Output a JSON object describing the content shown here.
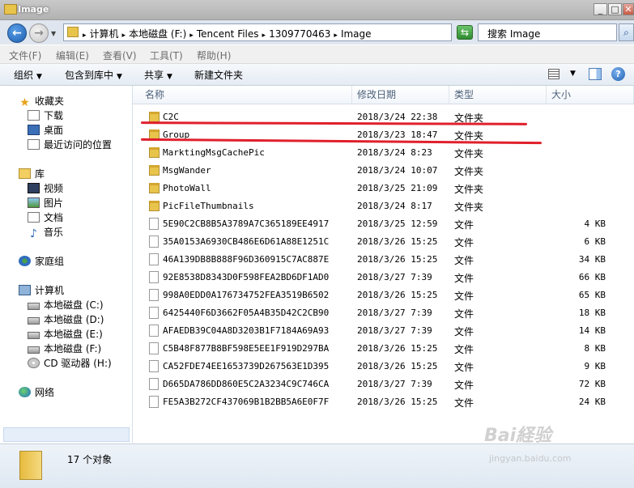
{
  "window": {
    "title": "Image"
  },
  "address": {
    "crumbs": [
      "计算机",
      "本地磁盘 (F:)",
      "Tencent Files",
      "1309770463",
      "Image"
    ],
    "separator": "▸"
  },
  "search": {
    "placeholder": "搜索 Image"
  },
  "menu": [
    "文件(F)",
    "编辑(E)",
    "查看(V)",
    "工具(T)",
    "帮助(H)"
  ],
  "toolbar": {
    "organize": "组织",
    "include": "包含到库中",
    "share": "共享",
    "new_folder": "新建文件夹"
  },
  "nav": {
    "favorites": "收藏夹",
    "downloads": "下载",
    "desktop": "桌面",
    "recent": "最近访问的位置",
    "libraries": "库",
    "videos": "视频",
    "pictures": "图片",
    "documents": "文档",
    "music": "音乐",
    "homegroup": "家庭组",
    "computer": "计算机",
    "drive_c": "本地磁盘 (C:)",
    "drive_d": "本地磁盘 (D:)",
    "drive_e": "本地磁盘 (E:)",
    "drive_f": "本地磁盘 (F:)",
    "cd_drive": "CD 驱动器 (H:)",
    "network": "网络"
  },
  "columns": {
    "name": "名称",
    "date": "修改日期",
    "type": "类型",
    "size": "大小"
  },
  "files": [
    {
      "name": "C2C",
      "date": "2018/3/24 22:38",
      "type": "文件夹",
      "size": "",
      "kind": "folder"
    },
    {
      "name": "Group",
      "date": "2018/3/23 18:47",
      "type": "文件夹",
      "size": "",
      "kind": "folder"
    },
    {
      "name": "MarktingMsgCachePic",
      "date": "2018/3/24 8:23",
      "type": "文件夹",
      "size": "",
      "kind": "folder"
    },
    {
      "name": "MsgWander",
      "date": "2018/3/24 10:07",
      "type": "文件夹",
      "size": "",
      "kind": "folder"
    },
    {
      "name": "PhotoWall",
      "date": "2018/3/25 21:09",
      "type": "文件夹",
      "size": "",
      "kind": "folder"
    },
    {
      "name": "PicFileThumbnails",
      "date": "2018/3/24 8:17",
      "type": "文件夹",
      "size": "",
      "kind": "folder"
    },
    {
      "name": "5E90C2CB8B5A3789A7C365189EE4917",
      "date": "2018/3/25 12:59",
      "type": "文件",
      "size": "4 KB",
      "kind": "file"
    },
    {
      "name": "35A0153A6930CB486E6D61A88E1251C",
      "date": "2018/3/26 15:25",
      "type": "文件",
      "size": "6 KB",
      "kind": "file"
    },
    {
      "name": "46A139DB8B888F96D360915C7AC887E",
      "date": "2018/3/26 15:25",
      "type": "文件",
      "size": "34 KB",
      "kind": "file"
    },
    {
      "name": "92E8538D8343D0F598FEA2BD6DF1AD0",
      "date": "2018/3/27 7:39",
      "type": "文件",
      "size": "66 KB",
      "kind": "file"
    },
    {
      "name": "998A0EDD0A176734752FEA3519B6502",
      "date": "2018/3/26 15:25",
      "type": "文件",
      "size": "65 KB",
      "kind": "file"
    },
    {
      "name": "6425440F6D3662F05A4B35D42C2CB90",
      "date": "2018/3/27 7:39",
      "type": "文件",
      "size": "18 KB",
      "kind": "file"
    },
    {
      "name": "AFAEDB39C04A8D3203B1F7184A69A93",
      "date": "2018/3/27 7:39",
      "type": "文件",
      "size": "14 KB",
      "kind": "file"
    },
    {
      "name": "C5B48F877B8BF598E5EE1F919D297BA",
      "date": "2018/3/26 15:25",
      "type": "文件",
      "size": "8 KB",
      "kind": "file"
    },
    {
      "name": "CA52FDE74EE1653739D267563E1D395",
      "date": "2018/3/26 15:25",
      "type": "文件",
      "size": "9 KB",
      "kind": "file"
    },
    {
      "name": "D665DA786DD860E5C2A3234C9C746CA",
      "date": "2018/3/27 7:39",
      "type": "文件",
      "size": "72 KB",
      "kind": "file"
    },
    {
      "name": "FE5A3B272CF437069B1B2BB5A6E0F7F",
      "date": "2018/3/26 15:25",
      "type": "文件",
      "size": "24 KB",
      "kind": "file"
    }
  ],
  "status": {
    "count": "17 个对象"
  },
  "watermark": {
    "main": "Bai経验",
    "sub": "jingyan.baidu.com"
  },
  "colors": {
    "annotation": "#e0202c",
    "selected_nav": "#e5eef9"
  }
}
